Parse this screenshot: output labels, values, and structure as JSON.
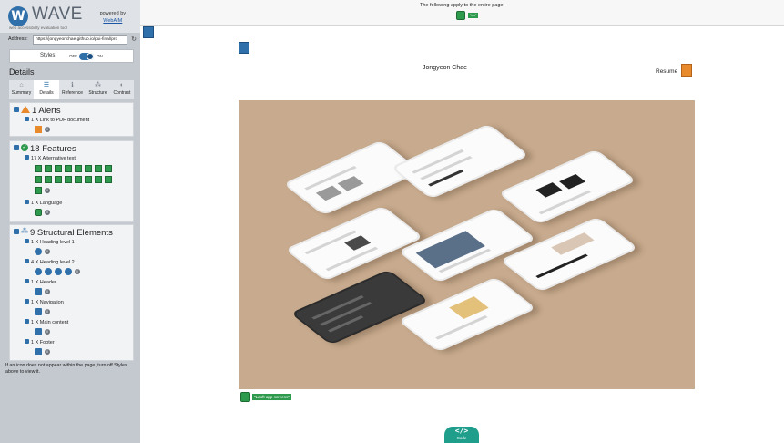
{
  "brand": {
    "name": "WAVE",
    "mark": "W",
    "tagline": "web accessibility evaluation tool",
    "powered_by": "powered by",
    "powered_link": "WebAIM"
  },
  "address": {
    "label": "Address:",
    "value": "https://jongyeonchae.github.io/pui-final/pro",
    "refresh_glyph": "↻"
  },
  "styles": {
    "label": "Styles:",
    "off": "OFF",
    "on": "ON",
    "state": "on"
  },
  "details": {
    "heading": "Details",
    "tabs": [
      {
        "label": "Summary",
        "glyph": "⌂",
        "active": false
      },
      {
        "label": "Details",
        "glyph": "☰",
        "active": true
      },
      {
        "label": "Reference",
        "glyph": "ℹ",
        "active": false
      },
      {
        "label": "Structure",
        "glyph": "⁂",
        "active": false
      },
      {
        "label": "Contrast",
        "glyph": "◐",
        "active": false
      }
    ],
    "alerts": {
      "title": "1 Alerts",
      "items": [
        {
          "label": "1 X Link to PDF document",
          "icon_count": 1
        }
      ]
    },
    "features": {
      "title": "18 Features",
      "items": [
        {
          "label": "17 X Alternative text",
          "icon_count": 17
        },
        {
          "label": "1 X Language",
          "icon_count": 1
        }
      ]
    },
    "structure": {
      "title": "9 Structural Elements",
      "items": [
        {
          "label": "1 X Heading level 1",
          "icon_count": 1
        },
        {
          "label": "4 X Heading level 2",
          "icon_count": 4
        },
        {
          "label": "1 X Header",
          "icon_count": 1
        },
        {
          "label": "1 X Navigation",
          "icon_count": 1
        },
        {
          "label": "1 X Main content",
          "icon_count": 1
        },
        {
          "label": "1 X Footer",
          "icon_count": 1
        }
      ]
    },
    "note": "If an icon does not appear within the page, turn off Styles above to view it."
  },
  "topbar": {
    "text": "The following apply to the entire page:",
    "lang_tag": "\"en\""
  },
  "page": {
    "name": "Jongyeon Chae",
    "resume": "Resume",
    "caption_tag": "\"Laoft app screens\""
  },
  "code": {
    "glyph": "</>",
    "label": "Code"
  },
  "info_glyph": "i",
  "colors": {
    "wave_blue": "#2f6faa",
    "alert_orange": "#e8892c",
    "feature_green": "#2e9a4d",
    "code_teal": "#1f9e8c",
    "hero_background": "#c8ab8e"
  }
}
